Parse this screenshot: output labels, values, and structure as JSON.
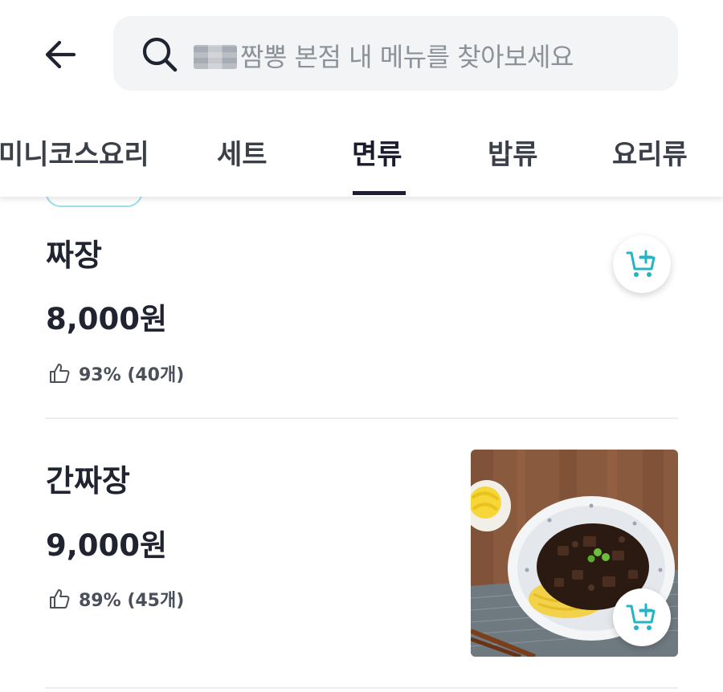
{
  "header": {
    "search": {
      "redacted_prefix": "",
      "placeholder": "짬뽕 본점 내 메뉴를 찾아보세요"
    }
  },
  "tabs": [
    {
      "label": "미니코스요리",
      "active": false
    },
    {
      "label": "세트",
      "active": false
    },
    {
      "label": "면류",
      "active": true
    },
    {
      "label": "밥류",
      "active": false
    },
    {
      "label": "요리류",
      "active": false
    }
  ],
  "menu": {
    "items": [
      {
        "name": "짜장",
        "price": "8,000원",
        "rating": "93% (40개)",
        "has_photo": false
      },
      {
        "name": "간짜장",
        "price": "9,000원",
        "rating": "89% (45개)",
        "has_photo": true
      }
    ]
  },
  "colors": {
    "accent": "#24b4c6",
    "tab_underline": "#1e1e33",
    "search_bg": "#f2f4f6",
    "text_primary": "#1f2430"
  },
  "icons": {
    "back": "arrow-left-icon",
    "search": "search-icon",
    "thumb": "thumb-up-icon",
    "cart": "cart-plus-icon"
  }
}
